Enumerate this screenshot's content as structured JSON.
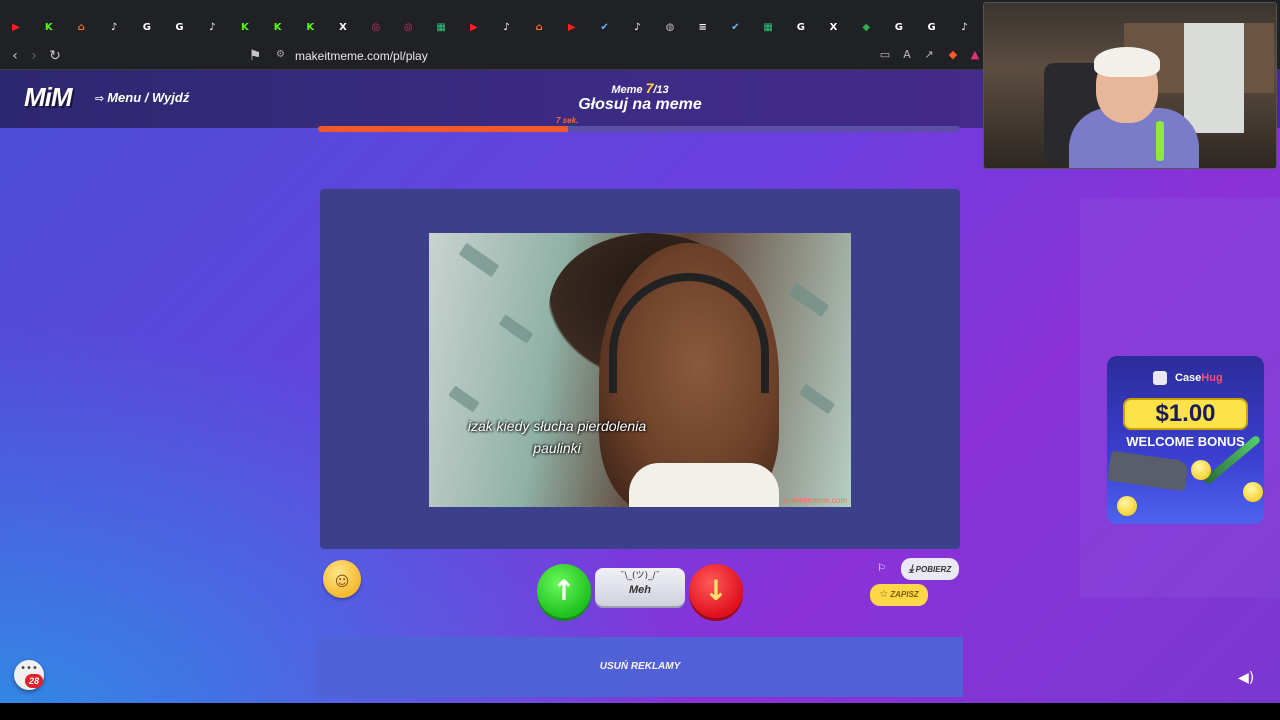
{
  "browser": {
    "url": "makeitmeme.com/pl/play",
    "tabs": [
      {
        "icon": "youtube-icon",
        "color": "#ff1f1f",
        "glyph": "▶"
      },
      {
        "icon": "kick-icon",
        "color": "#53fc18",
        "glyph": "K"
      },
      {
        "icon": "home-icon",
        "color": "#ff6a2a",
        "glyph": "⌂"
      },
      {
        "icon": "tiktok-icon",
        "color": "#ffffff",
        "glyph": "♪"
      },
      {
        "icon": "google-icon",
        "color": "#ffffff",
        "glyph": "G"
      },
      {
        "icon": "google-icon",
        "color": "#ffffff",
        "glyph": "G"
      },
      {
        "icon": "tiktok-icon",
        "color": "#ffffff",
        "glyph": "♪"
      },
      {
        "icon": "kick-icon",
        "color": "#53fc18",
        "glyph": "K"
      },
      {
        "icon": "kick-icon",
        "color": "#53fc18",
        "glyph": "K"
      },
      {
        "icon": "kick-icon",
        "color": "#53fc18",
        "glyph": "K"
      },
      {
        "icon": "x-icon",
        "color": "#ffffff",
        "glyph": "X"
      },
      {
        "icon": "instagram-icon",
        "color": "#e1306c",
        "glyph": "◎"
      },
      {
        "icon": "instagram-icon",
        "color": "#e1306c",
        "glyph": "◎"
      },
      {
        "icon": "sheets-icon",
        "color": "#34c37a",
        "glyph": "▦"
      },
      {
        "icon": "youtube-icon",
        "color": "#ff1f1f",
        "glyph": "▶"
      },
      {
        "icon": "tiktok-icon",
        "color": "#ffffff",
        "glyph": "♪"
      },
      {
        "icon": "home-icon",
        "color": "#ff6a2a",
        "glyph": "⌂"
      },
      {
        "icon": "youtube-icon",
        "color": "#ff1f1f",
        "glyph": "▶"
      },
      {
        "icon": "steam-icon",
        "color": "#66b3ff",
        "glyph": "✔"
      },
      {
        "icon": "tiktok-icon",
        "color": "#ffffff",
        "glyph": "♪"
      },
      {
        "icon": "globe-icon",
        "color": "#bbbbbb",
        "glyph": "◍"
      },
      {
        "icon": "stack-icon",
        "color": "#ffffff",
        "glyph": "≡"
      },
      {
        "icon": "steam-icon",
        "color": "#66b3ff",
        "glyph": "✔"
      },
      {
        "icon": "sheets-icon",
        "color": "#34c37a",
        "glyph": "▦"
      },
      {
        "icon": "google-icon",
        "color": "#ffffff",
        "glyph": "G"
      },
      {
        "icon": "x-icon",
        "color": "#ffffff",
        "glyph": "X"
      },
      {
        "icon": "maps-icon",
        "color": "#34a853",
        "glyph": "◆"
      },
      {
        "icon": "google-icon",
        "color": "#ffffff",
        "glyph": "G"
      },
      {
        "icon": "google-icon",
        "color": "#ffffff",
        "glyph": "G"
      },
      {
        "icon": "tiktok-icon",
        "color": "#ffffff",
        "glyph": "♪"
      }
    ]
  },
  "header": {
    "logo": "MiM",
    "menu_label": "Menu / Wyjdź",
    "meme_label": "Meme",
    "meme_current": "7",
    "meme_total": "/13",
    "title": "Głosuj na meme",
    "timer": "7 sek.",
    "timer_progress": 0.39
  },
  "meme": {
    "caption": "izak kiedy słucha pierdolenia paulinki",
    "watermark": "makeitmeme.com"
  },
  "voting": {
    "meh_shrug": "¯\\_(ツ)_/¯",
    "meh_label": "Meh"
  },
  "actions": {
    "download_label": "POBIERZ",
    "save_label": "ZAPISZ"
  },
  "ads": {
    "remove_label": "USUŃ REKLAMY",
    "banner_brand_a": "Case",
    "banner_brand_b": "Hug",
    "banner_price": "$1.00",
    "banner_bonus": "WELCOME BONUS"
  },
  "chat": {
    "badge_count": "28"
  },
  "colors": {
    "accent_orange": "#f05a2a",
    "vote_up": "#1fc21f",
    "vote_down": "#e0101c",
    "gold": "#ffcf3f"
  }
}
